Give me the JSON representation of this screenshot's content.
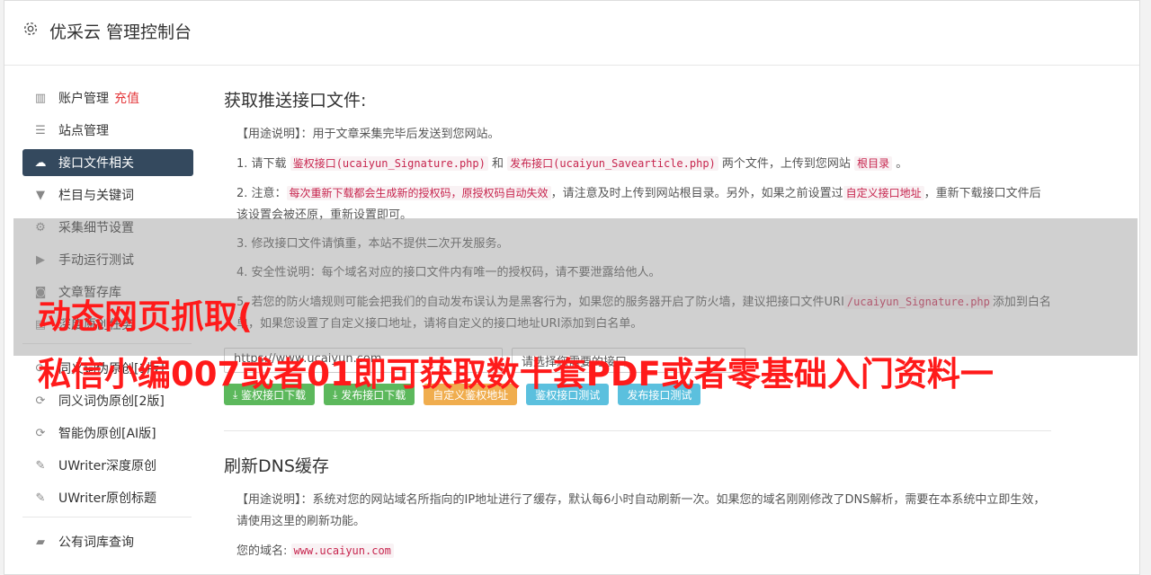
{
  "header": {
    "title": "优采云 管理控制台"
  },
  "sidebar": {
    "items": [
      {
        "label": "账户管理",
        "extra": "充值",
        "icon": "bar-chart-icon"
      },
      {
        "label": "站点管理",
        "icon": "server-icon"
      },
      {
        "label": "接口文件相关",
        "icon": "cloud-upload-icon",
        "active": true
      },
      {
        "label": "栏目与关键词",
        "icon": "filter-icon"
      },
      {
        "label": "采集细节设置",
        "icon": "gears-icon"
      },
      {
        "label": "手动运行测试",
        "icon": "play-circle-icon"
      },
      {
        "label": "文章暂存库",
        "icon": "database-icon"
      },
      {
        "label": "深度原创任务",
        "icon": "tasks-icon"
      }
    ],
    "items2": [
      {
        "label": "同义词伪原创[1版]",
        "icon": "refresh-icon"
      },
      {
        "label": "同义词伪原创[2版]",
        "icon": "refresh-icon"
      },
      {
        "label": "智能伪原创[AI版]",
        "icon": "refresh-icon"
      },
      {
        "label": "UWriter深度原创",
        "icon": "edit-icon"
      },
      {
        "label": "UWriter原创标题",
        "icon": "edit-icon"
      }
    ],
    "items3": [
      {
        "label": "公有词库查询",
        "icon": "book-icon"
      }
    ]
  },
  "section1": {
    "title": "获取推送接口文件:",
    "usage": "【用途说明】：用于文章采集完毕后发送到您网站。",
    "p1_a": "1. 请下载",
    "p1_code1": "鉴权接口(ucaiyun_Signature.php)",
    "p1_b": "和",
    "p1_code2": "发布接口(ucaiyun_Savearticle.php)",
    "p1_c": "两个文件，上传到您网站",
    "p1_code3": "根目录",
    "p1_d": "。",
    "p2_a": "2. 注意：",
    "p2_code1": "每次重新下载都会生成新的授权码，原授权码自动失效",
    "p2_b": "，请注意及时上传到网站根目录。另外，如果之前设置过",
    "p2_code2": "自定义接口地址",
    "p2_c": "，重新下载接口文件后该设置会被还原，重新设置即可。",
    "p3": "3. 修改接口文件请慎重，本站不提供二次开发服务。",
    "p4": "4. 安全性说明：每个域名对应的接口文件内有唯一的授权码，请不要泄露给他人。",
    "p5_a": "5. 若您的防火墙规则可能会把我们的自动发布误认为是黑客行为，如果您的服务器开启了防火墙，建议把接口文件URI",
    "p5_code": "/ucaiyun_Signature.php",
    "p5_b": "添加到白名单，如果您设置了自定义接口地址，请将自定义的接口地址URI添加到白名单。",
    "input_value": "https://www.ucaiyun.com",
    "select_value": "请选择您需要的接口",
    "buttons": {
      "sig_download": "鉴权接口下载",
      "pub_download": "发布接口下载",
      "custom_addr": "自定义鉴权地址",
      "sig_test": "鉴权接口测试",
      "pub_test": "发布接口测试"
    }
  },
  "section2": {
    "title": "刷新DNS缓存",
    "usage": "【用途说明】：系统对您的网站域名所指向的IP地址进行了缓存，默认每6小时自动刷新一次。如果您的域名刚刚修改了DNS解析，需要在本系统中立即生效，请使用这里的刷新功能。",
    "domain_label": "您的域名:",
    "domain_value": "www.ucaiyun.com"
  },
  "promo": {
    "line1": "动态网页抓取(",
    "line2": "私信小编007或者01即可获取数十套PDF或者零基础入门资料一"
  },
  "colors": {
    "sidebar_active": "#34495e",
    "green": "#5cb85c",
    "orange": "#f0ad4e",
    "blue": "#5bc0de",
    "promo": "#ff1a1a"
  }
}
